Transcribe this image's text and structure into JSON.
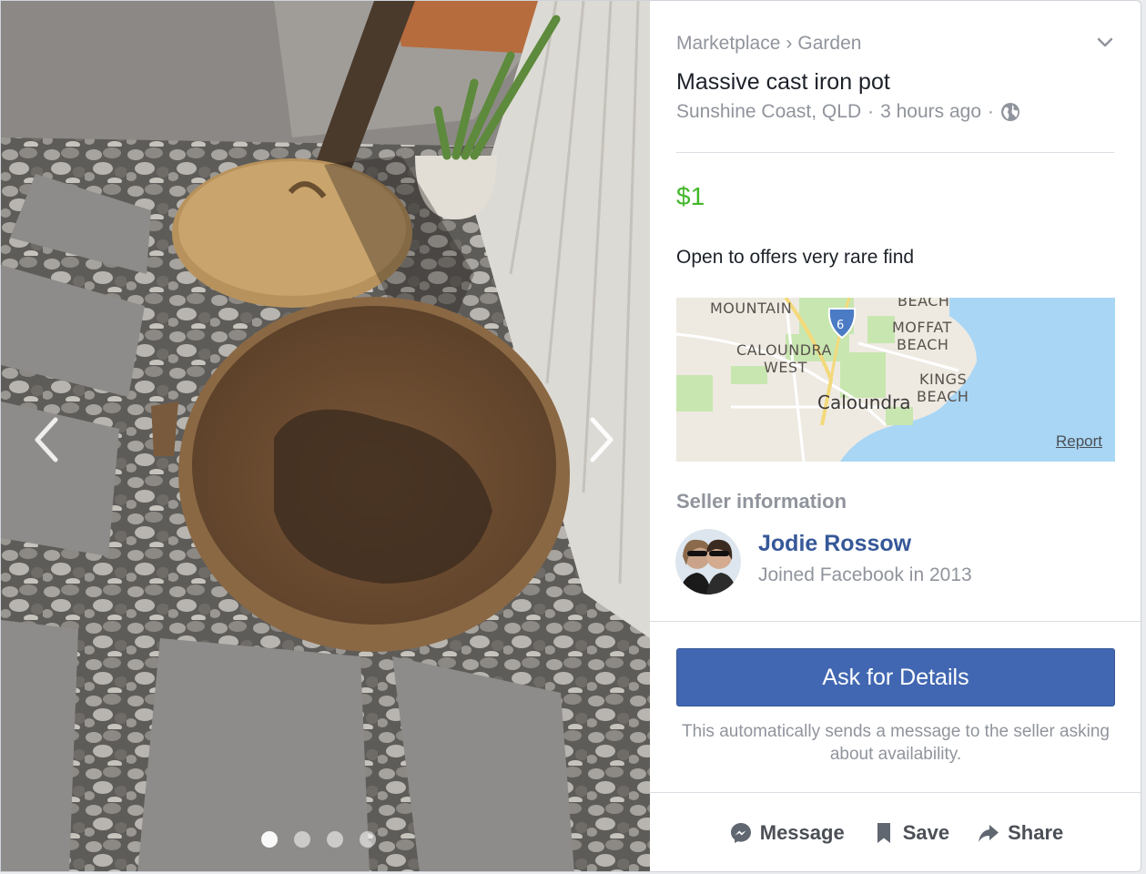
{
  "photo": {
    "carousel_count": 4,
    "active_index": 0
  },
  "listing": {
    "breadcrumb": [
      "Marketplace",
      "Garden"
    ],
    "breadcrumb_separator": "›",
    "title": "Massive cast iron pot",
    "location": "Sunshine Coast, QLD",
    "meta_separator": "·",
    "posted": "3 hours ago",
    "visibility_icon": "globe-icon",
    "price": "$1",
    "description": "Open to offers very rare find"
  },
  "map": {
    "labels": {
      "mountain": "MOUNTAIN",
      "beach_top": "BEACH",
      "moffat": "MOFFAT",
      "moffat_beach": "BEACH",
      "caloundra_west_1": "CALOUNDRA",
      "caloundra_west_2": "WEST",
      "kings": "KINGS",
      "kings_beach": "BEACH",
      "city": "Caloundra",
      "route_shield": "6"
    },
    "report_label": "Report"
  },
  "seller": {
    "heading": "Seller information",
    "name": "Jodie Rossow",
    "joined": "Joined Facebook in 2013"
  },
  "cta": {
    "button_label": "Ask for Details",
    "note": "This automatically sends a message to the seller asking about availability."
  },
  "actions": {
    "message": "Message",
    "save": "Save",
    "share": "Share"
  },
  "colors": {
    "price": "#42b72a",
    "button": "#4267b2",
    "link": "#365899",
    "muted": "#90949c"
  }
}
